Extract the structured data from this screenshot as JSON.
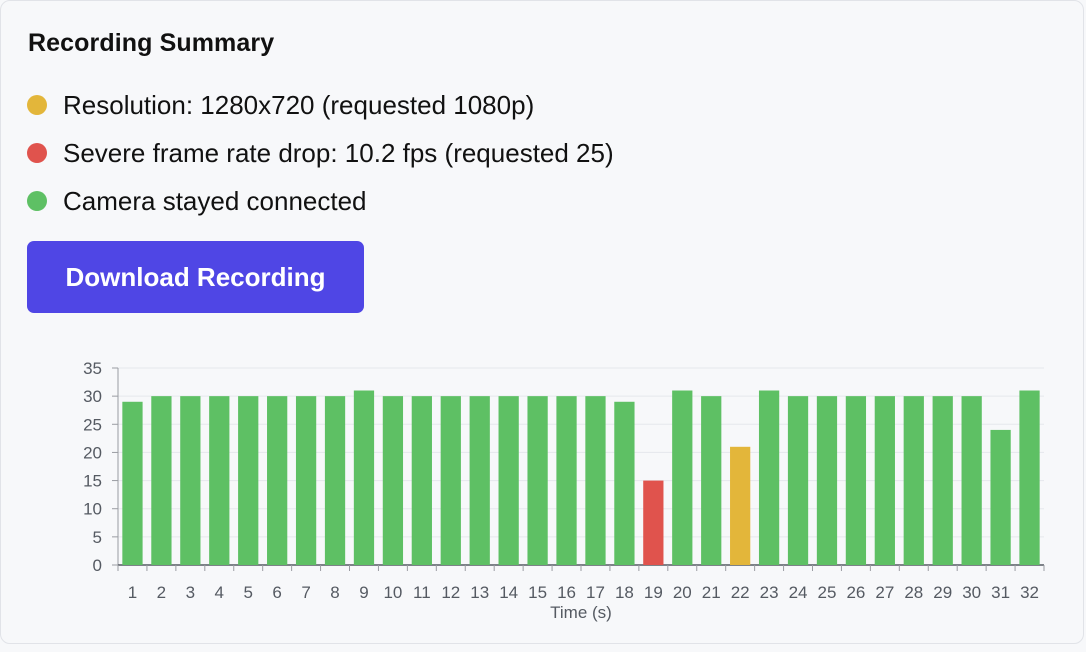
{
  "summary": {
    "title": "Recording Summary",
    "items": [
      {
        "text": "Resolution: 1280x720 (requested 1080p)",
        "status": "warning",
        "color": "#e3b63a"
      },
      {
        "text": "Severe frame rate drop: 10.2 fps (requested 25)",
        "status": "error",
        "color": "#e0534d"
      },
      {
        "text": "Camera stayed connected",
        "status": "ok",
        "color": "#5ec064"
      }
    ],
    "download_label": "Download Recording",
    "download_color": "#4f46e5"
  },
  "chart_data": {
    "type": "bar",
    "title": "",
    "xlabel": "Time (s)",
    "ylabel": "",
    "ylim": [
      0,
      35
    ],
    "yticks": [
      0,
      5,
      10,
      15,
      20,
      25,
      30,
      35
    ],
    "grid": true,
    "legend": "none",
    "categories": [
      "1",
      "2",
      "3",
      "4",
      "5",
      "6",
      "7",
      "8",
      "9",
      "10",
      "11",
      "12",
      "13",
      "14",
      "15",
      "16",
      "17",
      "18",
      "19",
      "20",
      "21",
      "22",
      "23",
      "24",
      "25",
      "26",
      "27",
      "28",
      "29",
      "30",
      "31",
      "32"
    ],
    "values": [
      29,
      30,
      30,
      30,
      30,
      30,
      30,
      30,
      31,
      30,
      30,
      30,
      30,
      30,
      30,
      30,
      30,
      29,
      15,
      31,
      30,
      21,
      31,
      30,
      30,
      30,
      30,
      30,
      30,
      30,
      24,
      31
    ],
    "bar_colors": {
      "ok": "#5ec064",
      "warning": "#e3b63a",
      "error": "#e0534d"
    },
    "bar_status": [
      "ok",
      "ok",
      "ok",
      "ok",
      "ok",
      "ok",
      "ok",
      "ok",
      "ok",
      "ok",
      "ok",
      "ok",
      "ok",
      "ok",
      "ok",
      "ok",
      "ok",
      "ok",
      "error",
      "ok",
      "ok",
      "warning",
      "ok",
      "ok",
      "ok",
      "ok",
      "ok",
      "ok",
      "ok",
      "ok",
      "ok",
      "ok"
    ]
  }
}
